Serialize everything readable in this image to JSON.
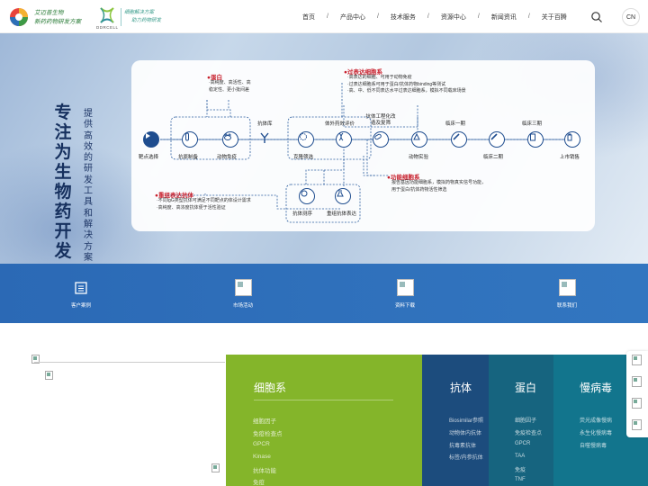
{
  "header": {
    "logo1_line1": "艾迈普生物",
    "logo1_line2": "新药药物研发方案",
    "logo2_brand": "DDRCELL",
    "logo2_slogan_line1": "细胞解决方案",
    "logo2_slogan_line2": "助力药物研发"
  },
  "nav": {
    "items": [
      "首页",
      "产品中心",
      "技术服务",
      "资源中心",
      "新闻资讯",
      "关于百腾"
    ],
    "separator": "/",
    "lang": "CN"
  },
  "hero": {
    "title": "专注为生物药开发",
    "subtitle": "提供高效的研发工具和解决方案"
  },
  "flow": {
    "main_steps": [
      "靶点选择",
      "抗原制备",
      "动物免疫",
      "抗体库",
      "克隆筛选",
      "体外药效评价",
      "抗体工程化改造及复筛",
      "动物实验",
      "临床一期",
      "临床二期",
      "临床三期",
      "上市销售"
    ],
    "sub_steps": [
      "抗体测序",
      "重组抗体表达"
    ],
    "protein": {
      "title": "蛋白",
      "desc1": "·高纯度、高活性、高",
      "desc2": "稳定性、更小批间差"
    },
    "overexpr": {
      "title": "过表达细胞系",
      "desc1": "·高表达的细胞、可用于动物免疫",
      "desc2": "·过表达细胞系可用于蛋白/抗体药物binding等测试",
      "desc3": "·高、中、低不同表达水平过表达细胞系，模拟不同载床场景"
    },
    "functional": {
      "title": "功能细胞系",
      "desc1": "报告基因功能细胞系，模拟药物真实信号功能，",
      "desc2": "用于蛋白/抗体药物活性筛选"
    },
    "recomb": {
      "title": "重组表达抗体",
      "desc1": "·不同IgG类型抗体可满足不同靶点的体设计需求",
      "desc2": "·高纯度、高浓度抗体便于活性验证"
    }
  },
  "quick_links": [
    {
      "label": "客户案例",
      "icon": "document-icon"
    },
    {
      "label": "市场活动",
      "icon": "broken-image-icon"
    },
    {
      "label": "资料下载",
      "icon": "broken-image-icon"
    },
    {
      "label": "联系我们",
      "icon": "broken-image-icon"
    }
  ],
  "categories": {
    "cell": {
      "title": "细胞系",
      "items": [
        "细胞因子",
        "免疫检查点",
        "GPCR",
        "Kinase",
        "抗体功能",
        "免疫"
      ]
    },
    "antibody": {
      "title": "抗体",
      "items": [
        "Biosimilar参照",
        "动物体内抗体",
        "抗毒素抗体",
        "标签/内参抗体"
      ]
    },
    "protein": {
      "title": "蛋白",
      "items": [
        "细胞因子",
        "免疫检查点",
        "GPCR",
        "TAA",
        "免疫",
        "TNF"
      ]
    },
    "chronic": {
      "title": "慢病毒",
      "items": [
        "荧光成像慢病",
        "永生化慢病毒",
        "自噬慢病毒"
      ]
    }
  },
  "colors": {
    "accent_green": "#84b52a",
    "navy": "#1c4c7d",
    "teal": "#12758d",
    "highlight_red": "#c8202d",
    "flow_blue": "#1f4d8f"
  }
}
